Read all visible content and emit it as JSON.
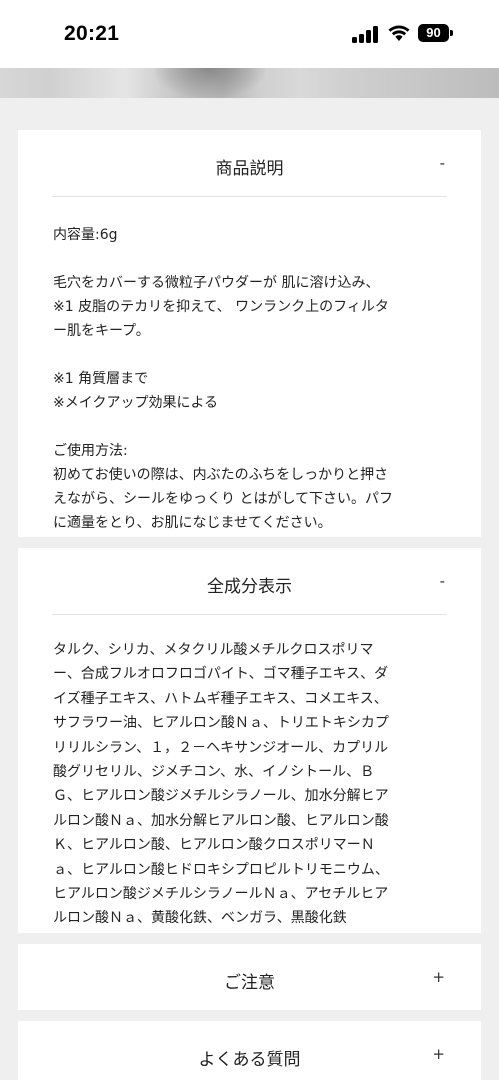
{
  "status_bar": {
    "time": "20:21",
    "battery": "90"
  },
  "description": {
    "title": "商品説明",
    "toggle": "-",
    "lines_block1": [
      "内容量:6g"
    ],
    "lines_block2": [
      "毛穴をカバーする微粒子パウダーが 肌に溶け込み、",
      "※1 皮脂のテカリを抑えて、 ワンランク上のフィルタ",
      "ー肌をキープ。"
    ],
    "lines_block3": [
      "※1 角質層まで",
      "※メイクアップ効果による"
    ],
    "lines_block4": [
      "ご使用方法:",
      "初めてお使いの際は、内ぶたのふちをしっかりと押さ",
      "えながら、シールをゆっくり とはがして下さい。パフ",
      "に適量をとり、お肌になじませてください。"
    ]
  },
  "ingredients": {
    "title": "全成分表示",
    "toggle": "-",
    "lines": [
      "タルク、シリカ、メタクリル酸メチルクロスポリマ",
      "ー、合成フルオロフロゴパイト、ゴマ種子エキス、ダ",
      "イズ種子エキス、ハトムギ種子エキス、コメエキス、",
      "サフラワー油、ヒアルロン酸Ｎａ、トリエトキシカプ",
      "リリルシラン、１，２－ヘキサンジオール、カプリル",
      "酸グリセリル、ジメチコン、水、イノシトール、Ｂ",
      "Ｇ、ヒアルロン酸ジメチルシラノール、加水分解ヒア",
      "ルロン酸Ｎａ、加水分解ヒアルロン酸、ヒアルロン酸",
      "Ｋ、ヒアルロン酸、ヒアルロン酸クロスポリマーＮ",
      "ａ、ヒアルロン酸ヒドロキシプロピルトリモニウム、",
      "ヒアルロン酸ジメチルシラノールＮａ、アセチルヒア",
      "ルロン酸Ｎａ、黄酸化鉄、ベンガラ、黒酸化鉄"
    ]
  },
  "caution": {
    "title": "ご注意",
    "toggle": "+"
  },
  "faq": {
    "title": "よくある質問",
    "toggle": "+"
  }
}
